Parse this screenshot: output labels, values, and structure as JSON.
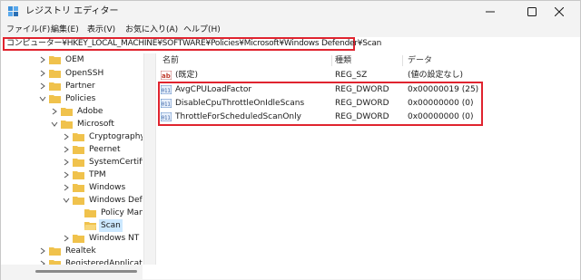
{
  "window": {
    "title": "レジストリ エディター"
  },
  "menu": [
    {
      "label": "ファイル(F)"
    },
    {
      "label": "編集(E)"
    },
    {
      "label": "表示(V)"
    },
    {
      "label": "お気に入り(A)"
    },
    {
      "label": "ヘルプ(H)"
    }
  ],
  "address": {
    "path": "コンピューター¥HKEY_LOCAL_MACHINE¥SOFTWARE¥Policies¥Microsoft¥Windows Defender¥Scan"
  },
  "tree": [
    {
      "label": "OEM",
      "expanded": false
    },
    {
      "label": "OpenSSH",
      "expanded": false
    },
    {
      "label": "Partner",
      "expanded": false
    },
    {
      "label": "Policies",
      "expanded": true
    },
    {
      "label": "Adobe",
      "expanded": false
    },
    {
      "label": "Microsoft",
      "expanded": true
    },
    {
      "label": "Cryptography",
      "expanded": false
    },
    {
      "label": "Peernet",
      "expanded": false
    },
    {
      "label": "SystemCertificates",
      "expanded": false
    },
    {
      "label": "TPM",
      "expanded": false
    },
    {
      "label": "Windows",
      "expanded": false
    },
    {
      "label": "Windows Defender",
      "expanded": true
    },
    {
      "label": "Policy Manager",
      "expanded": false
    },
    {
      "label": "Scan",
      "selected": true
    },
    {
      "label": "Windows NT",
      "expanded": false
    },
    {
      "label": "Realtek",
      "expanded": false
    },
    {
      "label": "RegisteredApplications",
      "expanded": false
    }
  ],
  "list": {
    "columns": [
      "名前",
      "種類",
      "データ"
    ],
    "rows": [
      {
        "icon": "string-value-icon",
        "name": "(既定)",
        "type": "REG_SZ",
        "data": "(値の設定なし)"
      },
      {
        "icon": "dword-value-icon",
        "name": "AvgCPULoadFactor",
        "type": "REG_DWORD",
        "data": "0x00000019 (25)"
      },
      {
        "icon": "dword-value-icon",
        "name": "DisableCpuThrottleOnIdleScans",
        "type": "REG_DWORD",
        "data": "0x00000000 (0)"
      },
      {
        "icon": "dword-value-icon",
        "name": "ThrottleForScheduledScanOnly",
        "type": "REG_DWORD",
        "data": "0x00000000 (0)"
      }
    ]
  },
  "colors": {
    "highlight_border": "#e0242f",
    "selection": "#cce8ff",
    "folder": "#f0c24c"
  }
}
